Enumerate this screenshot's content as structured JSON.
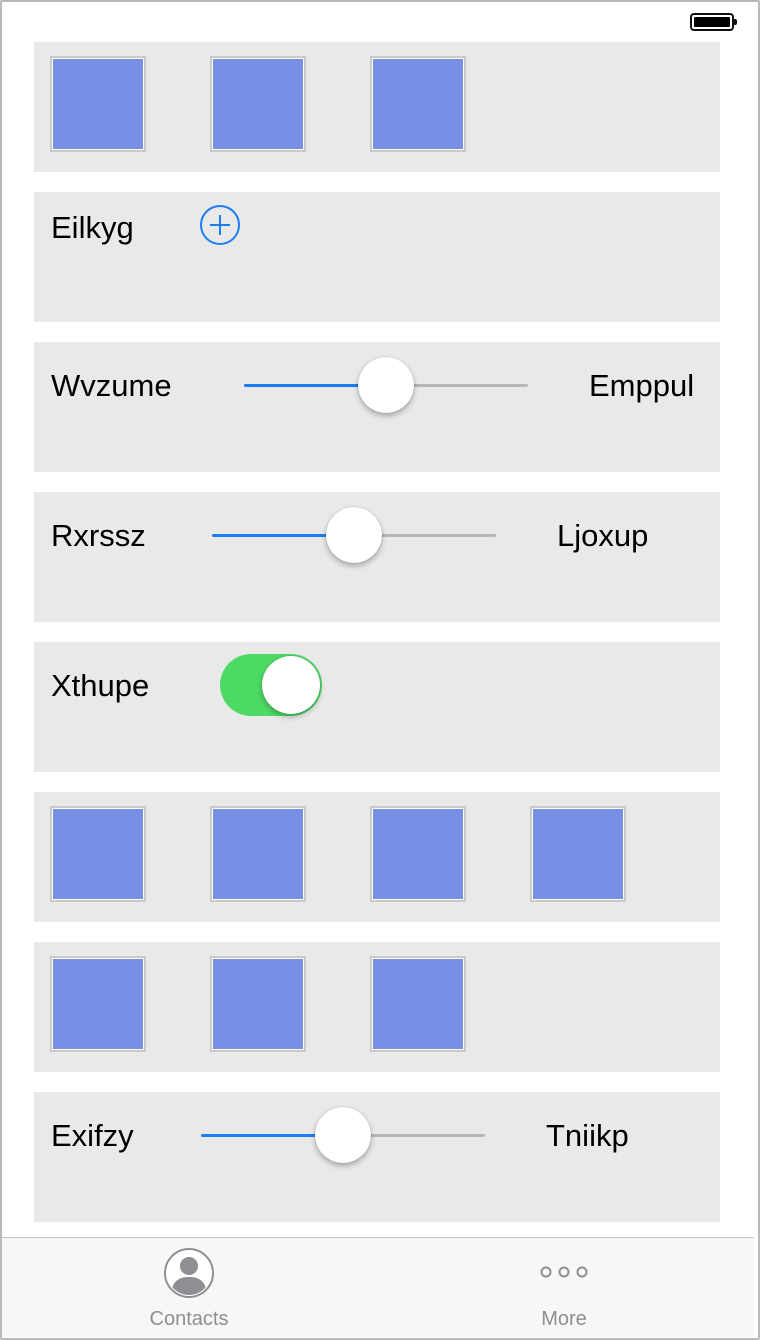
{
  "status_bar": {
    "battery_icon": "battery-full-icon"
  },
  "rows": {
    "row1": {
      "squares": 3
    },
    "row2": {
      "label": "Eilkyg",
      "button_icon": "add-circle-icon"
    },
    "row3": {
      "label": "Wvzume",
      "right_label": "Emppul",
      "value": 0.5
    },
    "row4": {
      "label": "Rxrssz",
      "right_label": "Ljoxup",
      "value": 0.5
    },
    "row5": {
      "label": "Xthupe",
      "toggle_on": true
    },
    "row6": {
      "squares": 4
    },
    "row7": {
      "squares": 3
    },
    "row8": {
      "label": "Exifzy",
      "right_label": "Tniikp",
      "value": 0.5
    }
  },
  "colors": {
    "accent": "#1a7ef7",
    "toggle_on": "#4cd964",
    "square": "#778fe5",
    "card_bg": "#e9e9e9"
  },
  "tabbar": {
    "tabs": [
      {
        "label": "Contacts",
        "icon": "contacts-icon"
      },
      {
        "label": "More",
        "icon": "more-icon"
      }
    ]
  }
}
